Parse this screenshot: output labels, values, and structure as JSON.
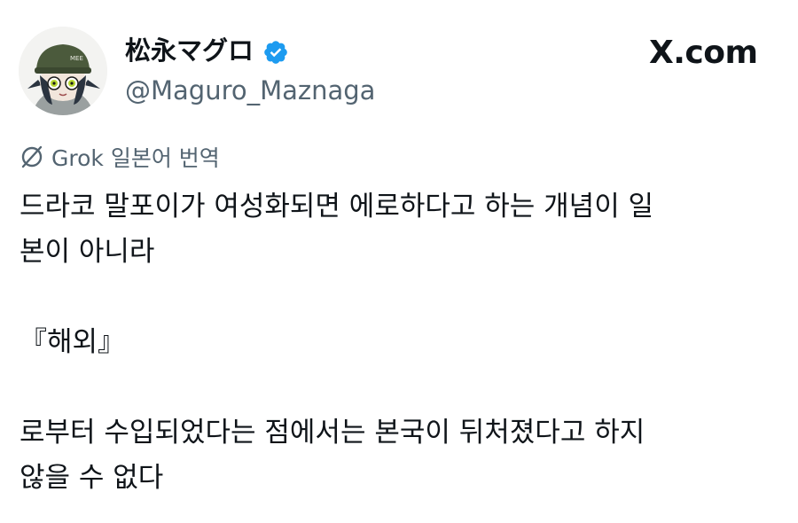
{
  "author": {
    "display_name": "松永マグロ",
    "handle": "@Maguro_Maznaga",
    "verified": true
  },
  "site_label": "X.com",
  "translation": {
    "label": "Grok 일본어 번역",
    "icon": "grok-icon"
  },
  "post": {
    "lines": [
      "드라코 말포이가 여성화되면 에로하다고 하는 개념이 일",
      "본이 아니라",
      "",
      "『해외』",
      "",
      "로부터 수입되었다는 점에서는 본국이 뒤처졌다고 하지",
      "않을 수 없다"
    ]
  },
  "colors": {
    "text": "#0f1419",
    "secondary": "#536471",
    "verified_badge": "#1d9bf0"
  }
}
